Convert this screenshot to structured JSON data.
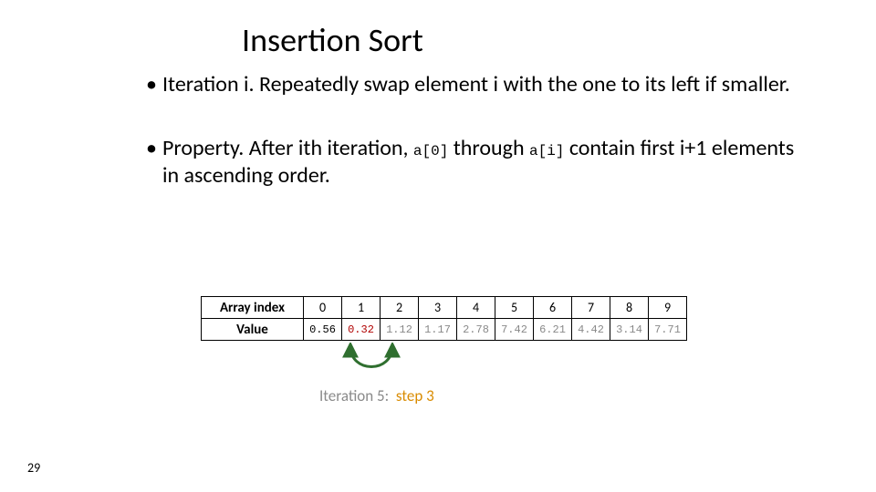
{
  "title": "Insertion Sort",
  "bullets": {
    "b1": "Iteration i.  Repeatedly swap element i with the one to its left if smaller.",
    "b2a": "Property.  After ith iteration, ",
    "b2code1": "a[0]",
    "b2b": " through ",
    "b2code2": "a[i]",
    "b2c": " contain first i+1 elements in ascending order."
  },
  "table": {
    "row_index_label": "Array index",
    "row_value_label": "Value",
    "indices": [
      "0",
      "1",
      "2",
      "3",
      "4",
      "5",
      "6",
      "7",
      "8",
      "9"
    ],
    "values": [
      "0.56",
      "0.32",
      "1.12",
      "1.17",
      "2.78",
      "7.42",
      "6.21",
      "4.42",
      "3.14",
      "7.71"
    ],
    "value_styles": [
      "active-black",
      "active-red",
      "",
      "",
      "",
      "",
      "",
      "",
      "",
      ""
    ]
  },
  "caption": {
    "prefix": "Iteration 5:",
    "suffix": "step 3"
  },
  "slide_number": "29"
}
